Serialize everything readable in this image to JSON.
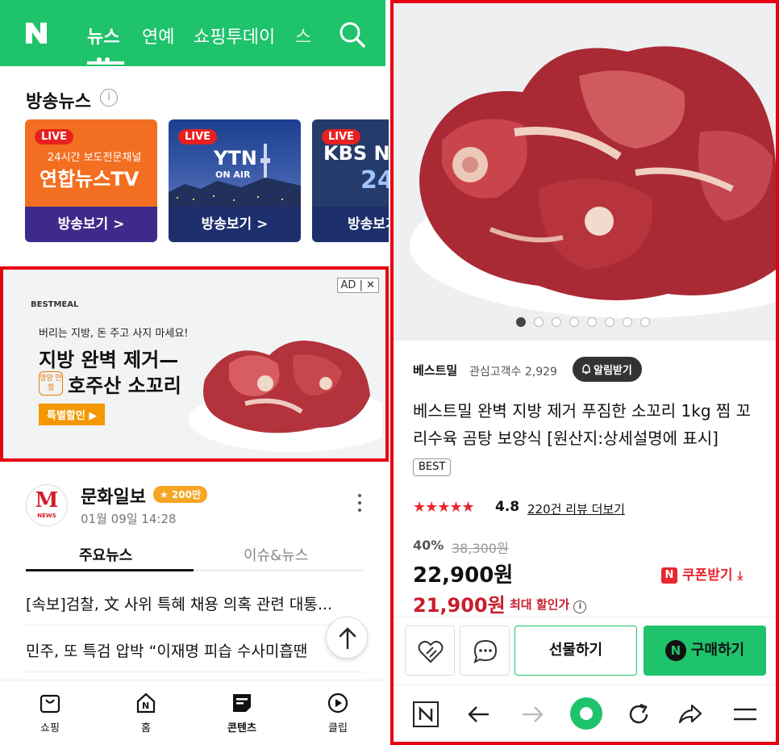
{
  "left": {
    "topnav": {
      "tabs": [
        "뉴스",
        "연예",
        "쇼핑투데이",
        "스"
      ],
      "active_tab": "뉴스",
      "accent": "#1ec36b"
    },
    "broadcast": {
      "title": "방송뉴스",
      "cards": [
        {
          "live": "LIVE",
          "line1": "24시간 보도전문채널",
          "line2": "연합뉴스TV",
          "button": "방송보기 >",
          "bg": "#f26f21",
          "btn_bg": "#3f2a8c"
        },
        {
          "live": "LIVE",
          "line1": "YTN",
          "line2": "ON AIR",
          "button": "방송보기 >",
          "bg": "#1f3d86",
          "btn_bg": "#1e2f6d"
        },
        {
          "live": "LIVE",
          "line1": "KBS N",
          "line2": "24",
          "button": "방송보기",
          "bg": "#243b6b",
          "btn_bg": "#1e2f6d"
        }
      ]
    },
    "ad": {
      "badge": "AD",
      "close": "✕",
      "brand": "BESTMEAL",
      "line1": "버리는 지방, 돈 주고 사지 마세요!",
      "line2": "지방 완벽 제거—",
      "tag": "영양 만점",
      "line3": "호주산 소꼬리",
      "button": "특별할인 ▶"
    },
    "publisher": {
      "logo": "M",
      "logo_sub": "NEWS",
      "name": "문화일보",
      "badge": "★ 200만",
      "time": "01월 09일 14:28"
    },
    "subtabs": [
      "주요뉴스",
      "이슈&뉴스"
    ],
    "news": [
      "[속보]검찰, 文 사위 특혜 채용 의혹 관련 대통...",
      "민주, 또 특검 압박 “이재명 피습 수사미흡땐"
    ],
    "bottomnav": [
      {
        "label": "쇼핑",
        "icon": "shopping-bag-icon"
      },
      {
        "label": "홈",
        "icon": "home-icon"
      },
      {
        "label": "콘텐츠",
        "icon": "contents-icon"
      },
      {
        "label": "클립",
        "icon": "clip-icon"
      }
    ]
  },
  "right": {
    "carousel": {
      "count": 8,
      "active": 0
    },
    "seller": "베스트밀",
    "interest": "관심고객수 2,929",
    "alarm": "알림받기",
    "title": "베스트밀 완벽 지방 제거 푸짐한 소꼬리 1kg 찜 꼬리수육 곰탕 보양식 [원산지:상세설명에 표시]",
    "best": "BEST",
    "stars": "★★★★★",
    "rating": "4.8",
    "reviews": "220건 리뷰 더보기",
    "discount": "40%",
    "original_price": "38,300원",
    "price": "22,900원",
    "coupon": "쿠폰받기",
    "coupon_badge": "N",
    "price_max": "21,900원",
    "max_discount": "최대 할인가",
    "gift": "선물하기",
    "buy": "구매하기",
    "buy_badge": "N"
  }
}
